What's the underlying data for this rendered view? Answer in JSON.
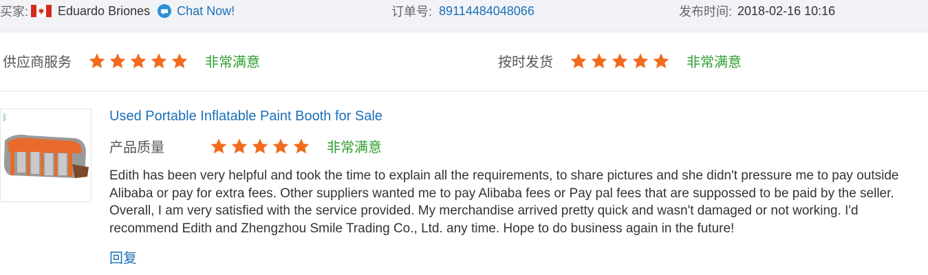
{
  "header": {
    "buyer_label": "买家:",
    "buyer_name": "Eduardo Briones",
    "chat_label": "Chat Now!",
    "order_label": "订单号:",
    "order_number": "89114484048066",
    "publish_label": "发布时间:",
    "publish_time": "2018-02-16 10:16"
  },
  "ratings": {
    "supplier_service_label": "供应商服务",
    "supplier_service_stars": 5,
    "supplier_service_text": "非常满意",
    "on_time_label": "按时发货",
    "on_time_stars": 5,
    "on_time_text": "非常满意"
  },
  "review": {
    "product_title": "Used Portable Inflatable Paint Booth for Sale",
    "quality_label": "产品质量",
    "quality_stars": 5,
    "quality_text": "非常满意",
    "text": "Edith has been very helpful and took the time to explain all the requirements, to share pictures and she didn't pressure me to pay outside Alibaba or pay for extra fees. Other suppliers wanted me to pay Alibaba fees or Pay pal fees that are suppossed to be paid by the seller. Overall, I am very satisfied with the service provided. My merchandise arrived pretty quick and wasn't damaged or not working. I'd recommend Edith and Zhengzhou Smile Trading Co., Ltd. any time. Hope to do business again in the future!",
    "reply_label": "回复"
  },
  "colors": {
    "star": "#f26b1d",
    "link": "#1a6fb8",
    "positive": "#2f9e2f",
    "topbar_bg": "#f2f3f7"
  },
  "icons": {
    "flag": "canada-flag-icon",
    "chat": "chat-bubble-icon",
    "star": "star-icon"
  }
}
